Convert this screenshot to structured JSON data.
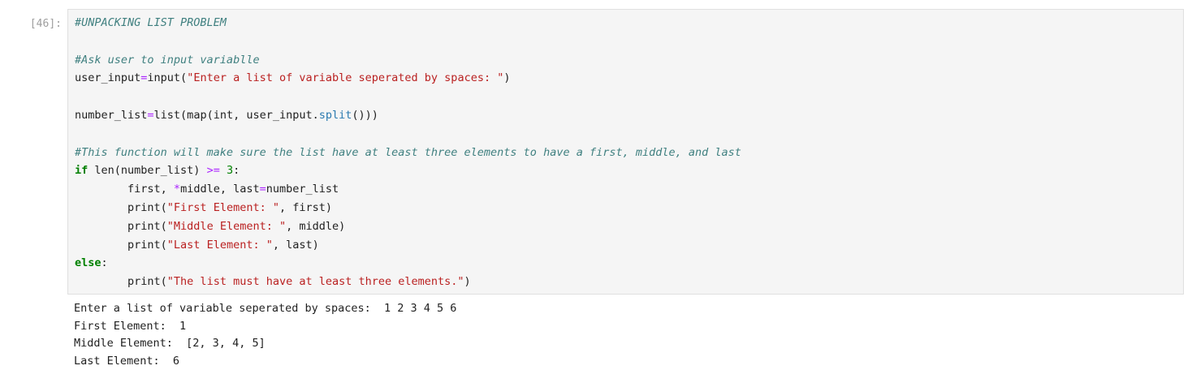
{
  "cell": {
    "prompt": "[46]:",
    "code": {
      "l1": "#UNPACKING LIST PROBLEM",
      "l3": "#Ask user to input variablle",
      "l4a": "user_input",
      "l4b": "=",
      "l4c": "input(",
      "l4d": "\"Enter a list of variable seperated by spaces: \"",
      "l4e": ")",
      "l6a": "number_list",
      "l6b": "=",
      "l6c": "list(map(int, user_input.",
      "l6d": "split",
      "l6e": "()))",
      "l8": "#This function will make sure the list have at least three elements to have a first, middle, and last",
      "l9a": "if",
      "l9b": " len(number_list) ",
      "l9c": ">=",
      "l9d": " ",
      "l9e": "3",
      "l9f": ":",
      "l10a": "        first, ",
      "l10b": "*",
      "l10c": "middle, last",
      "l10d": "=",
      "l10e": "number_list",
      "l11a": "        print(",
      "l11b": "\"First Element: \"",
      "l11c": ", first)",
      "l12a": "        print(",
      "l12b": "\"Middle Element: \"",
      "l12c": ", middle)",
      "l13a": "        print(",
      "l13b": "\"Last Element: \"",
      "l13c": ", last)",
      "l14a": "else",
      "l14b": ":",
      "l15a": "        print(",
      "l15b": "\"The list must have at least three elements.\"",
      "l15c": ")"
    },
    "output": [
      "Enter a list of variable seperated by spaces:  1 2 3 4 5 6",
      "First Element:  1",
      "Middle Element:  [2, 3, 4, 5]",
      "Last Element:  6"
    ]
  }
}
